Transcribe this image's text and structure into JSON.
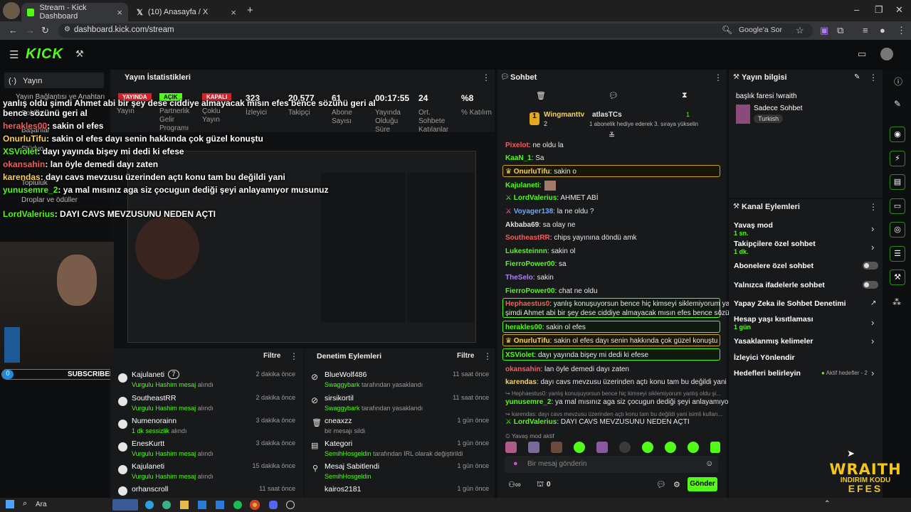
{
  "browser": {
    "tabs": [
      {
        "label": "Stream - Kick Dashboard"
      },
      {
        "label": "(10) Anasayfa / X"
      }
    ],
    "url": "dashboard.kick.com/stream",
    "google_ask": "Google'a Sor"
  },
  "nav": {
    "stream": "Yayın",
    "connection": "Yayın Bağlantısı ve Anahtarı",
    "chat": "Sohbet",
    "achievements": "Başarılar",
    "studio": "Stüdyo",
    "community": "Topluluk",
    "drops": "Droplar ve ödüller"
  },
  "stats": {
    "title": "Yayın İstatistikleri",
    "badges": [
      "YAYINDA",
      "AÇIK",
      "KAPALI"
    ],
    "items": [
      {
        "label": "Yayın",
        "value": ""
      },
      {
        "label": "Partnerlik Gelir Programı",
        "value": ""
      },
      {
        "label": "Çoklu Yayın",
        "value": ""
      },
      {
        "label": "İzleyici",
        "value": "323"
      },
      {
        "label": "Takipçi",
        "value": "20.577"
      },
      {
        "label": "Abone Sayısı",
        "value": "61"
      },
      {
        "label": "Yayında Olduğu Süre",
        "value": "00:17:55"
      },
      {
        "label": "Ort. Sohbete Katılanlar",
        "value": "24"
      },
      {
        "label": "% Katılım",
        "value": "%8"
      }
    ]
  },
  "overlay": [
    {
      "name": "",
      "text": "yanlış oldu şimdi Ahmet abi bir şey dese ciddiye almayacak mısın efes bence sözünü geri al"
    },
    {
      "name": "herakles00",
      "text": ": sakin ol efes"
    },
    {
      "name": "OnurluTifu",
      "text": ": sakin ol efes dayı senin hakkında çok güzel konuştu"
    },
    {
      "name": "XSViolet",
      "text": ": dayı yayında bişey mi dedi ki efese"
    },
    {
      "name": "okansahin",
      "text": ": lan öyle demedi dayı zaten"
    },
    {
      "name": "karendas",
      "text": ": dayı cavs mevzusu üzerinden açtı konu tam bu değildi yani"
    },
    {
      "name": "yunusemre_2",
      "text": ": ya mal mısınız aga siz çocugun dediği şeyi anlayamıyor musunuz"
    },
    {
      "name": "LordValerius",
      "text": ": DAYI CAVS MEVZUSUNU NEDEN AÇTI"
    }
  ],
  "subscribers": {
    "label": "SUBSCRIBERS",
    "count": "0"
  },
  "wraith": {
    "title": "WRAITH",
    "line2": "INDIRIM KODU",
    "line3": "EFES"
  },
  "activity": {
    "filter": "Filtre",
    "items": [
      {
        "name": "Kajulaneti",
        "count": "7",
        "sub_hl": "Vurgulu Hashim mesaj",
        "sub": " alındı",
        "time": "2 dakika önce"
      },
      {
        "name": "SoutheastRR",
        "sub_hl": "Vurgulu Hashim mesaj",
        "sub": " alındı",
        "time": "2 dakika önce"
      },
      {
        "name": "Numenorainn",
        "sub_hl": "1 dk sessizlik",
        "sub": " alındı",
        "time": "3 dakika önce"
      },
      {
        "name": "EnesKurtt",
        "sub_hl": "Vurgulu Hashim mesaj",
        "sub": " alındı",
        "time": "3 dakika önce"
      },
      {
        "name": "Kajulaneti",
        "sub_hl": "Vurgulu Hashim mesaj",
        "sub": " alındı",
        "time": "15 dakika önce"
      },
      {
        "name": "orhanscroll",
        "sub_hl": "",
        "sub": "",
        "time": "11 saat önce"
      }
    ]
  },
  "mod": {
    "title": "Denetim Eylemleri",
    "filter": "Filtre",
    "items": [
      {
        "name": "BlueWolf486",
        "sub_hl": "Swaggybark",
        "sub": " tarafından yasaklandı",
        "time": "11 saat önce"
      },
      {
        "name": "sirsikortil",
        "sub_hl": "Swaggybark",
        "sub": " tarafından yasaklandı",
        "time": "11 saat önce"
      },
      {
        "name": "cneaxzz",
        "sub_hl": "",
        "sub": "bir mesajı sildi",
        "time": "1 gün önce"
      },
      {
        "name": "Kategori",
        "sub_hl": "SemihHosgeldin",
        "sub": " tarafından IRL olarak değiştirildi",
        "time": "1 gün önce"
      },
      {
        "name": "Mesaj Sabitlendi",
        "sub_hl": "SemihHosgeldin",
        "sub": "",
        "time": "1 gün önce"
      },
      {
        "name": "kairos2181",
        "sub_hl": "",
        "sub": "",
        "time": "1 gün önce"
      }
    ]
  },
  "chat": {
    "title": "Sohbet",
    "gift": {
      "from": "Wingmanttv",
      "to": "atlasTCs",
      "count": "2",
      "count2": "1",
      "note": "1 abonelik hediye ederek 3. sıraya yükselin"
    },
    "messages": [
      {
        "name": "Pixelot",
        "color": "#ff5a5a",
        "text": ": ne oldu la"
      },
      {
        "name": "KaaN_1",
        "color": "#53fc18",
        "text": ": Sa"
      },
      {
        "name": "OnurluTifu",
        "color": "#ffd24a",
        "text": ": sakin o",
        "hl": true
      },
      {
        "name": "Kajulaneti",
        "color": "#53fc18",
        "text": ":"
      },
      {
        "name": "LordValerius",
        "color": "#53fc18",
        "text": ": AHMET ABİ"
      },
      {
        "name": "Voyager138",
        "color": "#6aa8ff",
        "text": ": la ne oldu ?"
      },
      {
        "name": "Akbaba69",
        "color": "#e0e0e0",
        "text": ": sa olay ne"
      },
      {
        "name": "SoutheastRR",
        "color": "#ff5a5a",
        "text": ": chips yayınına döndü amk"
      },
      {
        "name": "Lukesteinnn",
        "color": "#53fc18",
        "text": ": sakin ol"
      },
      {
        "name": "FierroPower00",
        "color": "#53fc18",
        "text": ": sa"
      },
      {
        "name": "TheSelo",
        "color": "#b07cff",
        "text": ": sakin"
      },
      {
        "name": "FierroPower00",
        "color": "#53fc18",
        "text": ": chat ne oldu"
      }
    ],
    "hl_messages": [
      {
        "name": "Hephaestus0",
        "color": "#ff5a5a",
        "text": ": yanlış konuşuyorsun bence hiç kimseyi siklemiyorum yanlış oldu",
        "text2": "şimdi Ahmet abi bir şey dese ciddiye almayacak mısın efes bence sözünü geri al"
      },
      {
        "name": "herakles00",
        "color": "#53fc18",
        "text": ": sakin ol efes"
      },
      {
        "name": "OnurluTifu",
        "color": "#ffd24a",
        "text": ": sakin ol efes dayı senin hakkında çok güzel konuştu"
      },
      {
        "name": "XSViolet",
        "color": "#53fc18",
        "text": ": dayı yayında bişey mi dedi ki efese"
      }
    ],
    "tail": [
      {
        "name": "okansahin",
        "color": "#ff5a5a",
        "text": ": lan öyle demedi dayı zaten"
      },
      {
        "name": "karendas",
        "color": "#ffd24a",
        "text": ": dayı cavs mevzusu üzerinden açtı konu tam bu değildi yani"
      },
      {
        "reply": "Hephaestus0: yanlış konuşuyorsun bence hiç kimseyi siklemiyorum yanlış oldu şi..."
      },
      {
        "name": "yunusemre_2",
        "color": "#53fc18",
        "text": ": ya mal mısınız aga siz çocugun dediği şeyi anlayamıyor musunuz"
      },
      {
        "reply": "karendas: dayı cavs mevzusu üzerinden açtı konu tam bu değildi yani isimli kullan..."
      },
      {
        "name": "LordValerius",
        "color": "#53fc18",
        "text": ": DAYI CAVS MEVZUSUNU NEDEN AÇTI"
      }
    ],
    "slow": "Yavaş mod aktif",
    "placeholder": "Bir mesaj gönderin",
    "points": "0",
    "send": "Gönder"
  },
  "info": {
    "title": "Yayın bilgisi",
    "stream_title": "başlık faresi !wraith",
    "category": "Sadece Sohbet",
    "tag": "Turkish"
  },
  "actions": {
    "title": "Kanal Eylemleri",
    "slow": {
      "label": "Yavaş mod",
      "sub": "1 sn."
    },
    "followers": {
      "label": "Takipçilere özel sohbet",
      "sub": "1 dk."
    },
    "subs": "Abonelere özel sohbet",
    "emotes": "Yalnızca ifadelerle sohbet",
    "ai": "Yapay Zeka ile Sohbet Denetimi",
    "age": {
      "label": "Hesap yaşı kısıtlaması",
      "sub": "1 gün"
    },
    "banned": "Yasaklanmış kelimeler",
    "redirect": "İzleyici Yönlendir",
    "goals": {
      "label": "Hedefleri belirleyin",
      "status": "Aktif hedefler - 2"
    }
  },
  "taskbar": {
    "search": "Ara"
  },
  "colors": {
    "accent": "#53fc18",
    "bg": "#0e0f10",
    "panel": "#18191b"
  }
}
